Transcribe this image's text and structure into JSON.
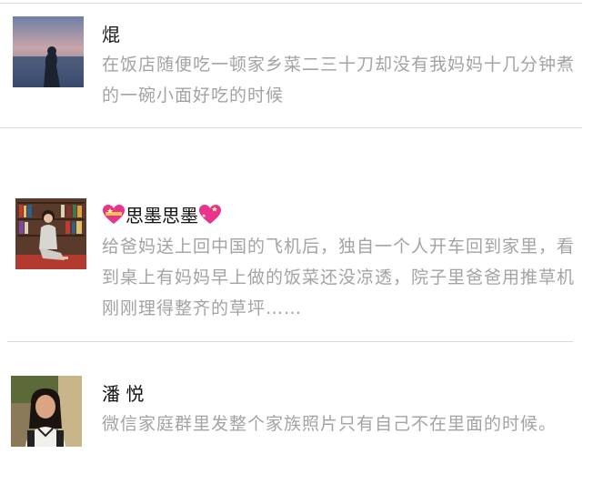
{
  "posts": [
    {
      "name": "焜",
      "text": "在饭店随便吃一顿家乡菜二三十刀却没有我妈妈十几分钟煮的一碗小面好吃的时候",
      "avatar_icon": "avatar-sunset-silhouette"
    },
    {
      "name": "思墨思墨",
      "name_prefix_icon": "sparkling-heart-icon",
      "name_suffix_icon": "sparkling-heart-icon",
      "text": "给爸妈送上回中国的飞机后，独自一个人开车回到家里，看到桌上有妈妈早上做的饭菜还没凉透，院子里爸爸用推草机刚刚理得整齐的草坪……",
      "avatar_icon": "avatar-bookshelf-photo"
    },
    {
      "name": "潘 悦",
      "text": "微信家庭群里发整个家族照片只有自己不在里面的时候。",
      "avatar_icon": "avatar-portrait-photo"
    }
  ],
  "colors": {
    "name": "#111111",
    "text": "#a3a3a3",
    "divider": "#d9d9d9",
    "heart": "#e8348d"
  }
}
